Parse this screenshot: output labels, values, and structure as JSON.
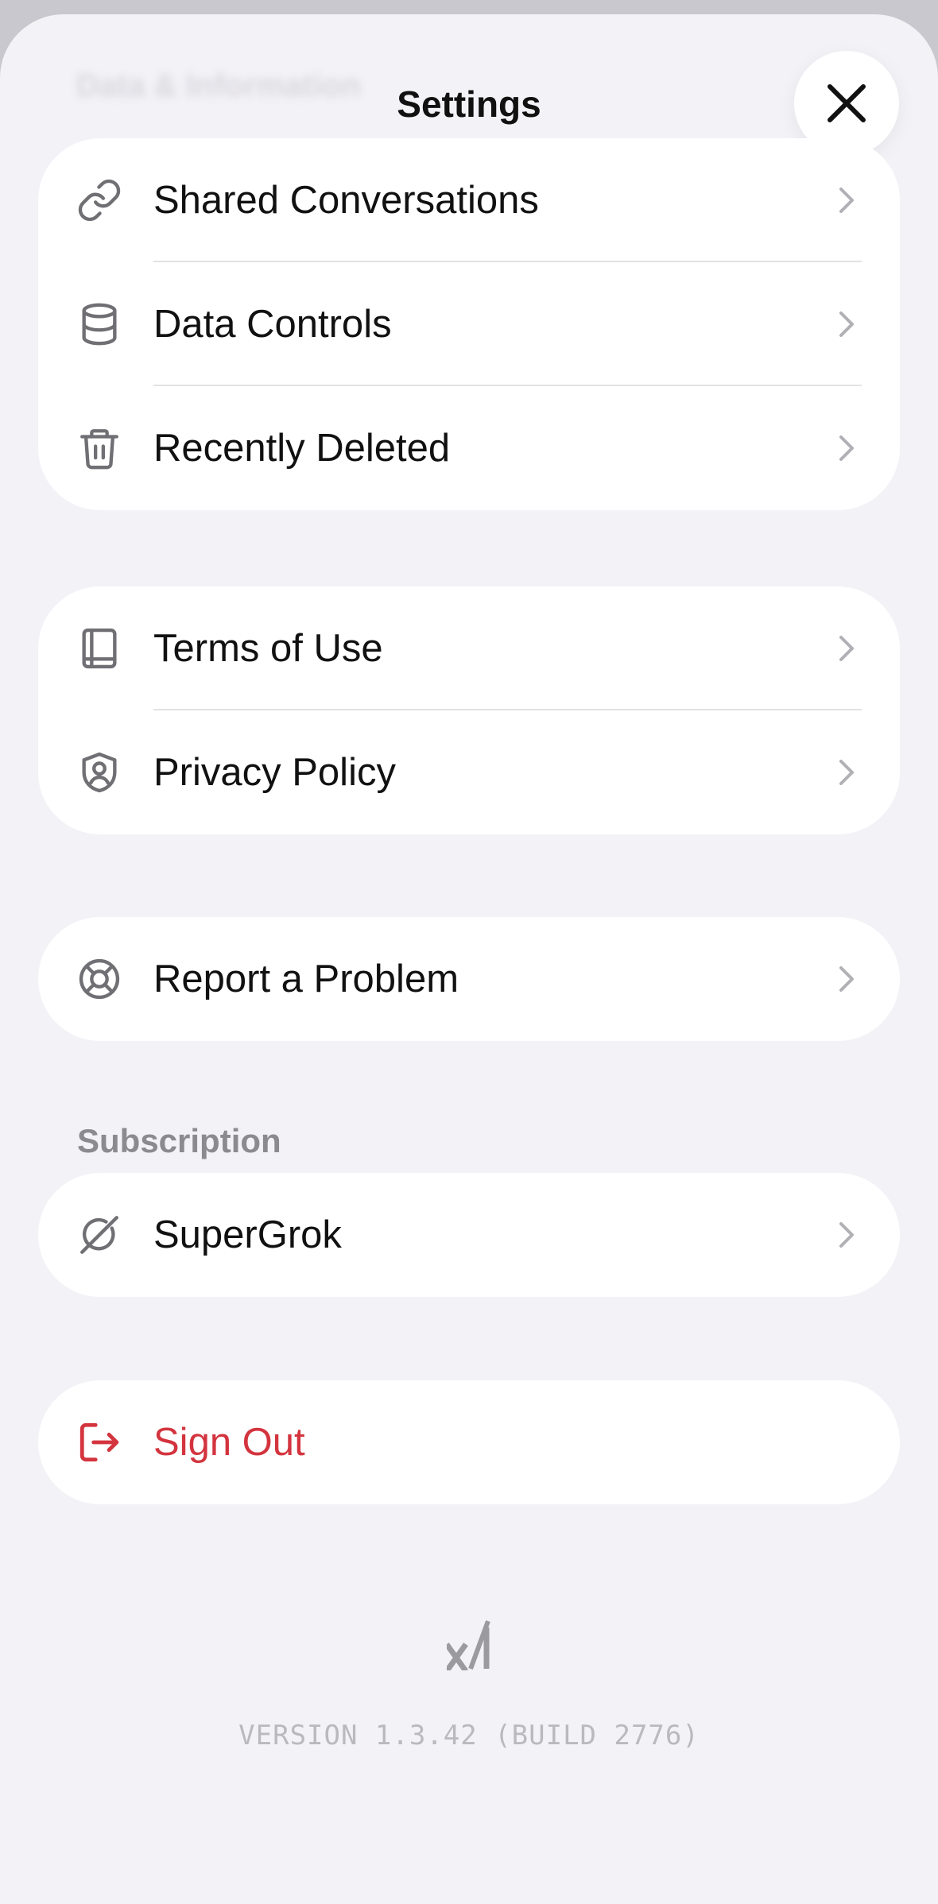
{
  "header": {
    "faded_heading": "Data & Information",
    "title": "Settings",
    "close_icon": "close-icon"
  },
  "data_section": {
    "items": [
      {
        "label": "Shared Conversations",
        "icon": "link-icon"
      },
      {
        "label": "Data Controls",
        "icon": "database-icon"
      },
      {
        "label": "Recently Deleted",
        "icon": "trash-icon"
      }
    ]
  },
  "legal_section": {
    "items": [
      {
        "label": "Terms of Use",
        "icon": "book-icon"
      },
      {
        "label": "Privacy Policy",
        "icon": "shield-user-icon"
      }
    ]
  },
  "support_section": {
    "items": [
      {
        "label": "Report a Problem",
        "icon": "lifebuoy-icon"
      }
    ]
  },
  "subscription_section": {
    "heading": "Subscription",
    "items": [
      {
        "label": "SuperGrok",
        "icon": "grok-icon"
      }
    ]
  },
  "account_section": {
    "items": [
      {
        "label": "Sign Out",
        "icon": "sign-out-icon"
      }
    ]
  },
  "footer": {
    "logo": "xai-logo",
    "version": "VERSION 1.3.42 (BUILD 2776)"
  },
  "colors": {
    "background": "#f3f2f7",
    "card": "#ffffff",
    "text": "#111111",
    "icon": "#6f6f74",
    "chevron": "#b0b0b5",
    "danger": "#d3343e",
    "muted": "#8a8a8f"
  }
}
